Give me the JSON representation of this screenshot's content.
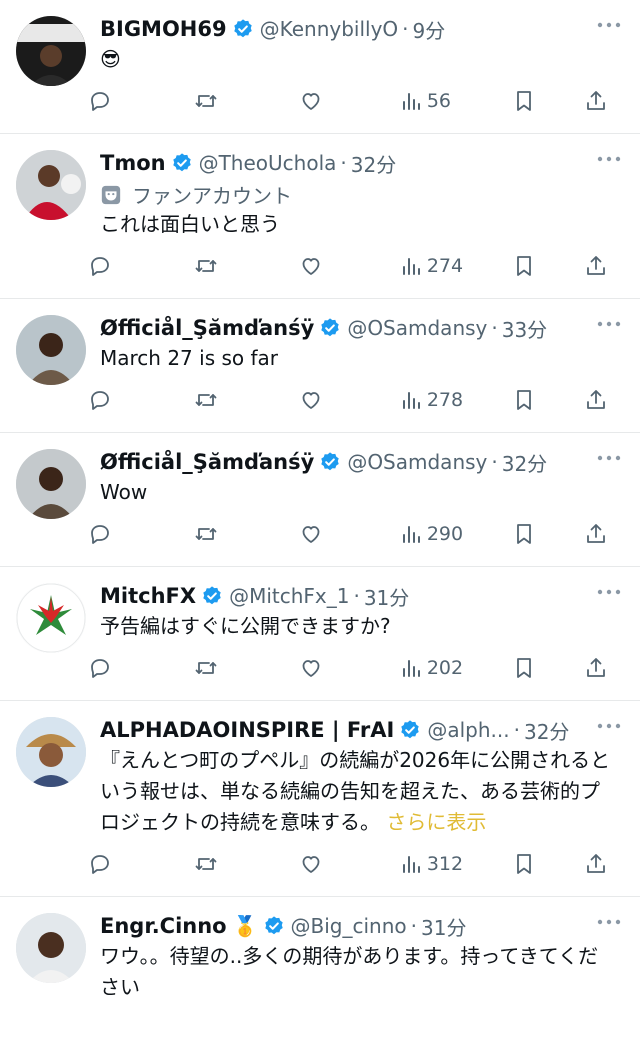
{
  "colors": {
    "text": "#0f1419",
    "secondary": "#536471",
    "verified": "#1d9bf0",
    "show_more": "#e0bb35",
    "divider": "#e7e9ea"
  },
  "tweets": [
    {
      "name": "BIGMOH69",
      "emoji": "",
      "verified": true,
      "handle": "@KennybillyO",
      "time": "9分",
      "label": "",
      "text": "😎",
      "show_more": "",
      "views": "56"
    },
    {
      "name": "Tmon",
      "emoji": "",
      "verified": true,
      "handle": "@TheoUchola",
      "time": "32分",
      "label": "ファンアカウント",
      "text": "これは面白いと思う",
      "show_more": "",
      "views": "274"
    },
    {
      "name": "Øfficiål_Şămďanśÿ",
      "emoji": "",
      "verified": true,
      "handle": "@OSamdansy",
      "time": "33分",
      "label": "",
      "text": "March 27 is so far",
      "show_more": "",
      "views": "278"
    },
    {
      "name": "Øfficiål_Şămďanśÿ",
      "emoji": "",
      "verified": true,
      "handle": "@OSamdansy",
      "time": "32分",
      "label": "",
      "text": "Wow",
      "show_more": "",
      "views": "290"
    },
    {
      "name": "MitchFX",
      "emoji": "",
      "verified": true,
      "handle": "@MitchFx_1",
      "time": "31分",
      "label": "",
      "text": "予告編はすぐに公開できますか?",
      "show_more": "",
      "views": "202"
    },
    {
      "name": "ALPHADAOINSPIRE | FrAI",
      "emoji": "",
      "verified": true,
      "handle": "@alph...",
      "time": "32分",
      "label": "",
      "text": "『えんとつ町のプペル』の続編が2026年に公開されるという報せは、単なる続編の告知を超えた、ある芸術的プロジェクトの持続を意味する。",
      "show_more": "さらに表示",
      "views": "312"
    },
    {
      "name": "Engr.Cinno",
      "emoji": "🥇",
      "verified": true,
      "handle": "@Big_cinno",
      "time": "31分",
      "label": "",
      "text": "ワウ。。待望の..多くの期待があります。持ってきてください",
      "show_more": "",
      "views": ""
    }
  ]
}
